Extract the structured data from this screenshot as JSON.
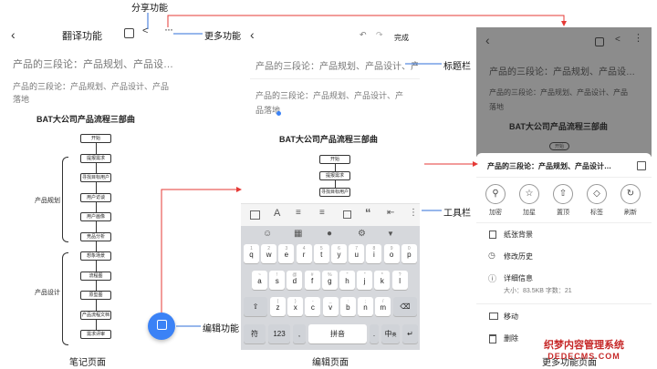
{
  "note_page": {
    "caption": "笔记页面",
    "title": "产品的三段论：产品规划、产品设…",
    "body_line1": "产品的三段论：产品规划、产品设计、产品",
    "body_line2": "落地",
    "doc_heading": "BAT大公司产品流程三部曲",
    "flow_boxes": [
      "开始",
      "提报需求",
      "寻找目标用户",
      "用户访谈",
      "用户画像",
      "竞品分析",
      "想象场景",
      "流程图",
      "原型图",
      "产品流程文档",
      "需求评审"
    ],
    "section_labels": [
      "产品规划",
      "产品设计"
    ]
  },
  "edit_page": {
    "caption": "编辑页面",
    "done": "完成",
    "title": "产品的三段论：产品规划、产品设计、产",
    "body_line1": "产品的三段论：产品规划、产品设计、产",
    "body_line2": "品落地",
    "doc_heading": "BAT大公司产品流程三部曲",
    "flow_boxes": [
      "开始",
      "提报需求",
      "寻找目标用户"
    ],
    "keyboard": {
      "row1": [
        [
          "1",
          "q"
        ],
        [
          "2",
          "w"
        ],
        [
          "3",
          "e"
        ],
        [
          "4",
          "r"
        ],
        [
          "5",
          "t"
        ],
        [
          "6",
          "y"
        ],
        [
          "7",
          "u"
        ],
        [
          "8",
          "i"
        ],
        [
          "9",
          "o"
        ],
        [
          "0",
          "p"
        ]
      ],
      "row2": [
        [
          "~",
          "a"
        ],
        [
          "!",
          "s"
        ],
        [
          "@",
          "d"
        ],
        [
          "#",
          "f"
        ],
        [
          "%",
          "g"
        ],
        [
          "\"",
          "h"
        ],
        [
          "\"",
          "j"
        ],
        [
          "*",
          "k"
        ],
        [
          "?",
          "l"
        ]
      ],
      "row3": [
        [
          "(",
          "z"
        ],
        [
          ")",
          "x"
        ],
        [
          "-",
          "c"
        ],
        [
          "_",
          "v"
        ],
        [
          ":",
          "b"
        ],
        [
          ";",
          "n"
        ],
        [
          "/",
          "m"
        ]
      ],
      "sym": "符",
      "num": "123",
      "space": "拼音",
      "lang": "中",
      "lang_sub": "英"
    }
  },
  "more_page": {
    "caption": "更多功能页面",
    "sheet_title": "产品的三段论：产品规划、产品设计…",
    "actions": [
      "加密",
      "加星",
      "置顶",
      "标签",
      "刷新"
    ],
    "items": {
      "paper": "纸张背景",
      "history": "修改历史",
      "detail": "详细信息",
      "detail_sub": "大小：83.5KB 字数：21",
      "move": "移动",
      "delete": "删除"
    }
  },
  "annotations": {
    "share": "分享功能",
    "translate": "翻译功能",
    "more": "更多功能",
    "title_bar": "标题栏",
    "toolbar": "工具栏",
    "edit": "编辑功能"
  },
  "watermark": {
    "line1": "织梦内容管理系统",
    "line2": "DEDECMS.COM"
  },
  "colors": {
    "accent_blue": "#3b82f6",
    "arrow_red": "#e53935",
    "annot_blue": "#2f6fd8",
    "overlay": "#888888"
  }
}
